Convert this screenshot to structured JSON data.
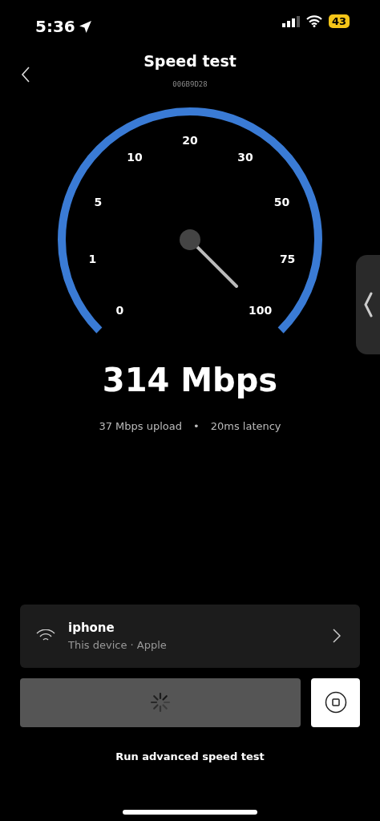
{
  "status_bar": {
    "time": "5:36",
    "battery": "43"
  },
  "header": {
    "title": "Speed test",
    "subtitle": "006B9D28"
  },
  "gauge": {
    "labels": [
      "0",
      "1",
      "5",
      "10",
      "20",
      "30",
      "50",
      "75",
      "100"
    ]
  },
  "result": {
    "speed": "314 Mbps",
    "upload": "37 Mbps upload",
    "separator": "•",
    "latency": "20ms latency"
  },
  "device": {
    "name": "iphone",
    "detail": "This device · Apple"
  },
  "run_button": {
    "loading": true
  },
  "advanced_link": "Run advanced speed test"
}
